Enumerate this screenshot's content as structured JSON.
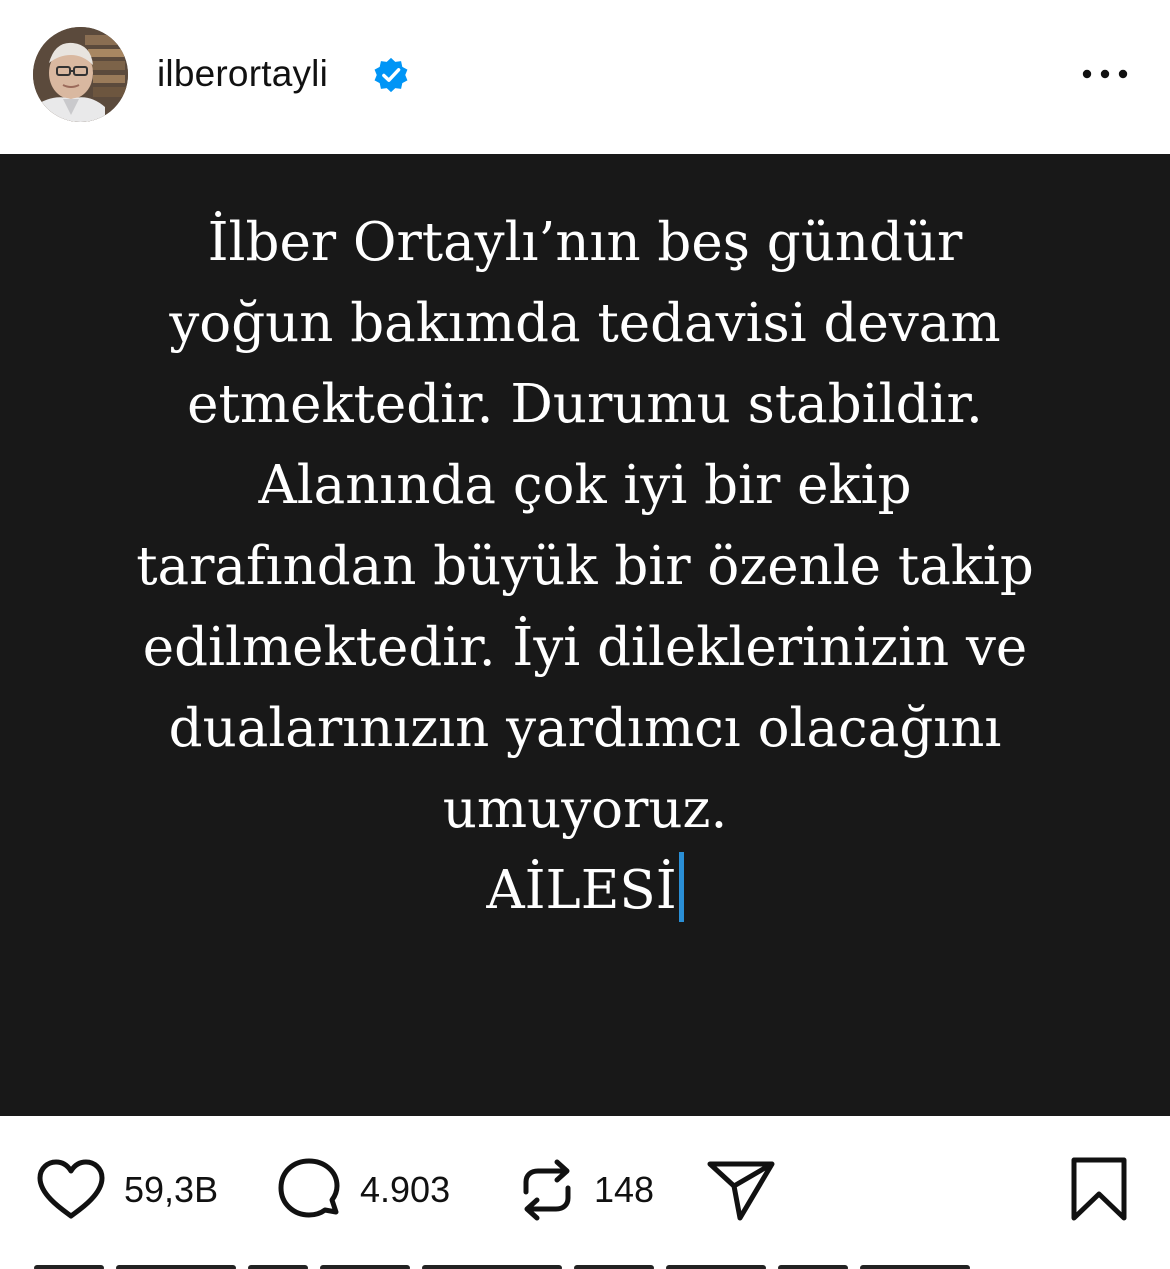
{
  "header": {
    "username": "ilberortayli",
    "verified_icon": "verified-badge-icon",
    "more_icon": "more-options-icon"
  },
  "post": {
    "lines": [
      "İlber Ortaylı’nın beş gündür",
      "yoğun bakımda tedavisi devam",
      "etmektedir. Durumu stabildir.",
      "Alanında çok iyi bir ekip",
      "tarafından büyük bir özenle takip",
      "edilmektedir. İyi dileklerinizin ve",
      "dualarınızın yardımcı olacağını",
      "umuyoruz.",
      "AİLESİ"
    ],
    "background_color": "#181818",
    "text_color": "#ffffff",
    "cursor_color": "#2a8fd6"
  },
  "actions": {
    "like_count": "59,3B",
    "comment_count": "4.903",
    "repost_count": "148",
    "like_icon": "heart-icon",
    "comment_icon": "comment-bubble-icon",
    "repost_icon": "repost-icon",
    "share_icon": "send-icon",
    "bookmark_icon": "bookmark-icon"
  },
  "colors": {
    "verified_blue": "#0095f6",
    "text_dark": "#111111"
  }
}
